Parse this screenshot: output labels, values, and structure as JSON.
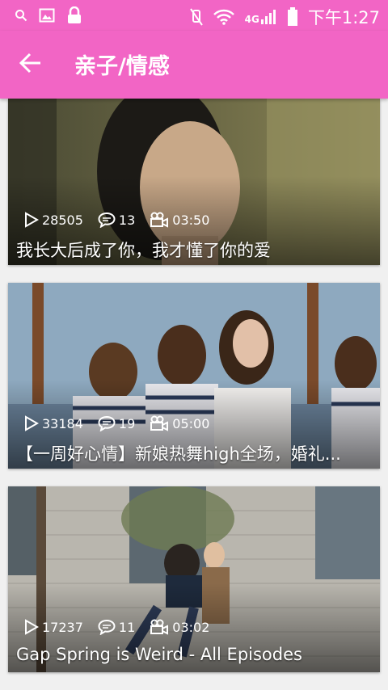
{
  "status_bar": {
    "time": "下午1:27",
    "network": "4G",
    "icons": [
      "search-icon",
      "image-icon",
      "lock-icon",
      "mute-icon",
      "wifi-icon",
      "signal-icon",
      "battery-icon"
    ]
  },
  "app_bar": {
    "title": "亲子/情感",
    "back_icon": "back-arrow-icon",
    "color": "#f265c5"
  },
  "videos": [
    {
      "plays": "28505",
      "comments": "13",
      "duration": "03:50",
      "title": "我长大后成了你，我才懂了你的爱"
    },
    {
      "plays": "33184",
      "comments": "19",
      "duration": "05:00",
      "title": "【一周好心情】新娘热舞high全场，婚礼..."
    },
    {
      "plays": "17237",
      "comments": "11",
      "duration": "03:02",
      "title": "Gap Spring is Weird - All Episodes"
    }
  ]
}
